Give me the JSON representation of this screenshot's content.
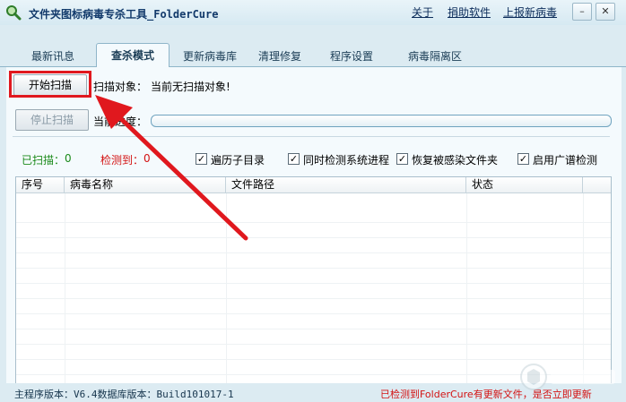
{
  "window": {
    "title": "文件夹图标病毒专杀工具_FolderCure",
    "links": {
      "about": "关于",
      "donate": "捐助软件",
      "report": "上报新病毒"
    },
    "controls": {
      "minimize": "–",
      "close": "✕"
    }
  },
  "tabs": [
    {
      "label": "最新讯息"
    },
    {
      "label": "查杀模式",
      "active": true
    },
    {
      "label": "更新病毒库"
    },
    {
      "label": "清理修复"
    },
    {
      "label": "程序设置"
    },
    {
      "label": "病毒隔离区"
    }
  ],
  "scan": {
    "start_button": "开始扫描",
    "stop_button": "停止扫描",
    "target_label": "扫描对象：",
    "target_value": "当前无扫描对象!",
    "progress_label": "当前进度：",
    "progress_fraction": 0
  },
  "stats": {
    "scanned_label": "已扫描：",
    "scanned_value": "0",
    "detected_label": "检测到：",
    "detected_value": "0"
  },
  "options": [
    {
      "label": "遍历子目录",
      "checked": true
    },
    {
      "label": "同时检测系统进程",
      "checked": true
    },
    {
      "label": "恢复被感染文件夹",
      "checked": true
    },
    {
      "label": "启用广谱检测",
      "checked": true
    }
  ],
  "table": {
    "columns": [
      "序号",
      "病毒名称",
      "文件路径",
      "状态"
    ],
    "rows": []
  },
  "status": {
    "left": "主程序版本：V6.4数据库版本：Build101017-1",
    "right": "已检测到FolderCure有更新文件，是否立即更新"
  },
  "colors": {
    "highlight": "#e0181e",
    "arrow": "#e0181e",
    "scanned": "#1a8a1a",
    "detected": "#d31212"
  }
}
